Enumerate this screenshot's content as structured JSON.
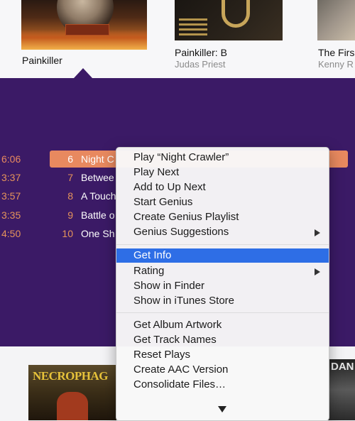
{
  "albums_top": [
    {
      "title": "Painkiller",
      "artist": ""
    },
    {
      "title": "Painkiller: B",
      "artist": "Judas Priest"
    },
    {
      "title": "The Firs",
      "artist": "Kenny R"
    }
  ],
  "tracks": [
    {
      "duration": "6:06",
      "number": "6",
      "name": "Night C",
      "selected": true
    },
    {
      "duration": "3:37",
      "number": "7",
      "name": "Betwee"
    },
    {
      "duration": "3:57",
      "number": "8",
      "name": "A Touch"
    },
    {
      "duration": "3:35",
      "number": "9",
      "name": "Battle o"
    },
    {
      "duration": "4:50",
      "number": "10",
      "name": "One Sh"
    }
  ],
  "context_menu": {
    "groups": [
      [
        {
          "label": "Play “Night Crawler”"
        },
        {
          "label": "Play Next"
        },
        {
          "label": "Add to Up Next"
        },
        {
          "label": "Start Genius"
        },
        {
          "label": "Create Genius Playlist"
        },
        {
          "label": "Genius Suggestions",
          "submenu": true
        }
      ],
      [
        {
          "label": "Get Info",
          "highlighted": true
        },
        {
          "label": "Rating",
          "submenu": true
        },
        {
          "label": "Show in Finder"
        },
        {
          "label": "Show in iTunes Store"
        }
      ],
      [
        {
          "label": "Get Album Artwork"
        },
        {
          "label": "Get Track Names"
        },
        {
          "label": "Reset Plays"
        },
        {
          "label": "Create AAC Version"
        },
        {
          "label": "Consolidate Files…"
        }
      ]
    ],
    "scroll_indicator_icon": "triangle-down-icon"
  },
  "albums_bottom": [
    {
      "cover_text": "NECROPHAG"
    },
    {
      "cover_text": "DAN"
    }
  ],
  "colors": {
    "panel_bg": "#3b1a66",
    "accent_orange": "#e8895f",
    "menu_highlight": "#2e6ee6"
  }
}
